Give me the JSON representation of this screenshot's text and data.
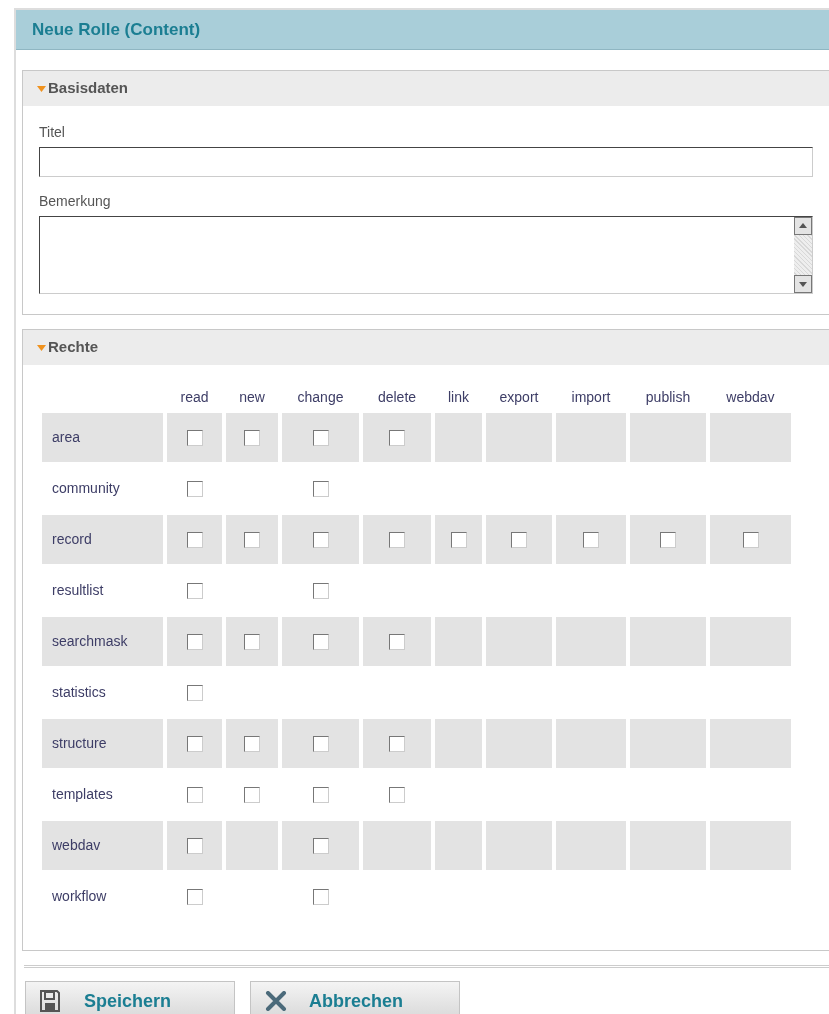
{
  "window": {
    "title": "Neue Rolle (Content)"
  },
  "basisdaten": {
    "title": "Basisdaten",
    "expanded": true,
    "fields": [
      {
        "kind": "input",
        "label": "Titel"
      },
      {
        "kind": "textarea",
        "label": "Bemerkung"
      }
    ]
  },
  "rechte": {
    "title": "Rechte",
    "expanded": true,
    "columns": [
      "read",
      "new",
      "change",
      "delete",
      "link",
      "export",
      "import",
      "publish",
      "webdav"
    ],
    "rows": [
      {
        "name": "area",
        "cells": [
          {
            "kind": "checkbox",
            "checked": false
          },
          {
            "kind": "checkbox",
            "checked": false
          },
          {
            "kind": "checkbox",
            "checked": false
          },
          {
            "kind": "checkbox",
            "checked": false
          },
          {
            "kind": "empty"
          },
          {
            "kind": "empty"
          },
          {
            "kind": "empty"
          },
          {
            "kind": "empty"
          },
          {
            "kind": "empty"
          }
        ]
      },
      {
        "name": "community",
        "cells": [
          {
            "kind": "checkbox",
            "checked": false
          },
          {
            "kind": "empty"
          },
          {
            "kind": "checkbox",
            "checked": false
          },
          {
            "kind": "empty"
          },
          {
            "kind": "empty"
          },
          {
            "kind": "empty"
          },
          {
            "kind": "empty"
          },
          {
            "kind": "empty"
          },
          {
            "kind": "empty"
          }
        ]
      },
      {
        "name": "record",
        "cells": [
          {
            "kind": "checkbox",
            "checked": false
          },
          {
            "kind": "checkbox",
            "checked": false
          },
          {
            "kind": "checkbox",
            "checked": false
          },
          {
            "kind": "checkbox",
            "checked": false
          },
          {
            "kind": "checkbox",
            "checked": false
          },
          {
            "kind": "checkbox",
            "checked": false
          },
          {
            "kind": "checkbox",
            "checked": false
          },
          {
            "kind": "checkbox",
            "checked": false
          },
          {
            "kind": "checkbox",
            "checked": false
          }
        ]
      },
      {
        "name": "resultlist",
        "cells": [
          {
            "kind": "checkbox",
            "checked": false
          },
          {
            "kind": "empty"
          },
          {
            "kind": "checkbox",
            "checked": false
          },
          {
            "kind": "empty"
          },
          {
            "kind": "empty"
          },
          {
            "kind": "empty"
          },
          {
            "kind": "empty"
          },
          {
            "kind": "empty"
          },
          {
            "kind": "empty"
          }
        ]
      },
      {
        "name": "searchmask",
        "cells": [
          {
            "kind": "checkbox",
            "checked": false
          },
          {
            "kind": "checkbox",
            "checked": false
          },
          {
            "kind": "checkbox",
            "checked": false
          },
          {
            "kind": "checkbox",
            "checked": false
          },
          {
            "kind": "empty"
          },
          {
            "kind": "empty"
          },
          {
            "kind": "empty"
          },
          {
            "kind": "empty"
          },
          {
            "kind": "empty"
          }
        ]
      },
      {
        "name": "statistics",
        "cells": [
          {
            "kind": "checkbox",
            "checked": false
          },
          {
            "kind": "empty"
          },
          {
            "kind": "empty"
          },
          {
            "kind": "empty"
          },
          {
            "kind": "empty"
          },
          {
            "kind": "empty"
          },
          {
            "kind": "empty"
          },
          {
            "kind": "empty"
          },
          {
            "kind": "empty"
          }
        ]
      },
      {
        "name": "structure",
        "cells": [
          {
            "kind": "checkbox",
            "checked": false
          },
          {
            "kind": "checkbox",
            "checked": false
          },
          {
            "kind": "checkbox",
            "checked": false
          },
          {
            "kind": "checkbox",
            "checked": false
          },
          {
            "kind": "empty"
          },
          {
            "kind": "empty"
          },
          {
            "kind": "empty"
          },
          {
            "kind": "empty"
          },
          {
            "kind": "empty"
          }
        ]
      },
      {
        "name": "templates",
        "cells": [
          {
            "kind": "checkbox",
            "checked": false
          },
          {
            "kind": "checkbox",
            "checked": false
          },
          {
            "kind": "checkbox",
            "checked": false
          },
          {
            "kind": "checkbox",
            "checked": false
          },
          {
            "kind": "empty"
          },
          {
            "kind": "empty"
          },
          {
            "kind": "empty"
          },
          {
            "kind": "empty"
          },
          {
            "kind": "empty"
          }
        ]
      },
      {
        "name": "webdav",
        "cells": [
          {
            "kind": "checkbox",
            "checked": false
          },
          {
            "kind": "empty"
          },
          {
            "kind": "checkbox",
            "checked": false
          },
          {
            "kind": "empty"
          },
          {
            "kind": "empty"
          },
          {
            "kind": "empty"
          },
          {
            "kind": "empty"
          },
          {
            "kind": "empty"
          },
          {
            "kind": "empty"
          }
        ]
      },
      {
        "name": "workflow",
        "cells": [
          {
            "kind": "checkbox",
            "checked": false
          },
          {
            "kind": "empty"
          },
          {
            "kind": "checkbox",
            "checked": false
          },
          {
            "kind": "empty"
          },
          {
            "kind": "empty"
          },
          {
            "kind": "empty"
          },
          {
            "kind": "empty"
          },
          {
            "kind": "empty"
          },
          {
            "kind": "empty"
          }
        ]
      }
    ]
  },
  "buttons": [
    {
      "kind": "save",
      "label": "Speichern"
    },
    {
      "kind": "cancel",
      "label": "Abbrechen"
    }
  ]
}
